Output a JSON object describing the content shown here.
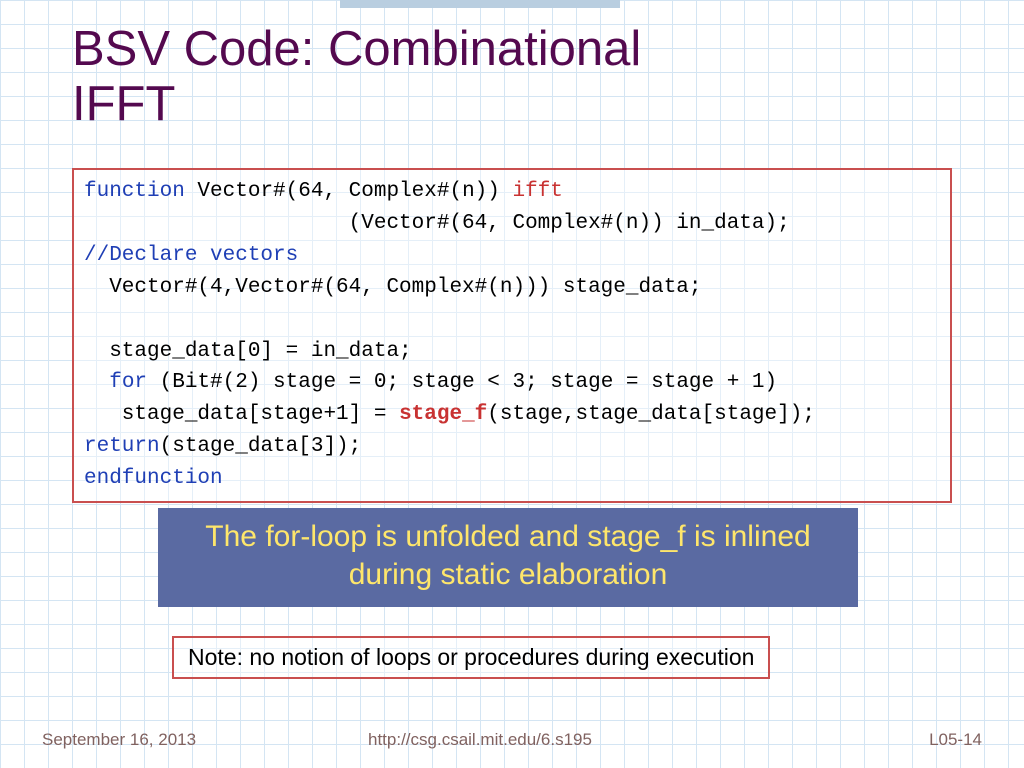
{
  "title_line1": "BSV Code: Combinational",
  "title_line2": "IFFT",
  "code": {
    "kw_function": "function",
    "sig1": " Vector#(64, Complex#(n)) ",
    "kw_ifft": "ifft",
    "sig2": "                     (Vector#(64, Complex#(n)) in_data);",
    "comment": "//Declare vectors",
    "decl": "  Vector#(4,Vector#(64, Complex#(n))) stage_data;",
    "blank": "",
    "assign0": "  stage_data[0] = in_data;",
    "for_indent": "  ",
    "kw_for": "for",
    "for_args": " (Bit#(2) stage = 0; stage < 3; stage = stage + 1)",
    "body_pre": "   stage_data[stage+1] = ",
    "kw_stagef": "stage_f",
    "body_post": "(stage,stage_data[stage]);",
    "kw_return": "return",
    "ret_args": "(stage_data[3]);",
    "kw_endfunction": "endfunction"
  },
  "callout": "The for-loop is unfolded and  stage_f is inlined during static elaboration",
  "note": "Note: no notion of loops or procedures during execution",
  "footer": {
    "date": "September 16, 2013",
    "url": "http://csg.csail.mit.edu/6.s195",
    "page": "L05-14"
  }
}
